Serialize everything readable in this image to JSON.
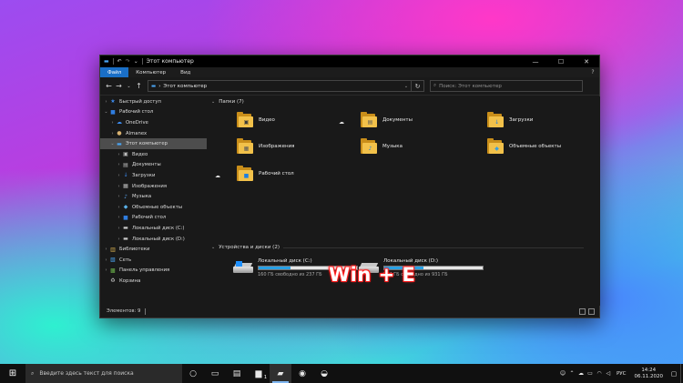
{
  "window": {
    "title": "Этот компьютер",
    "controls": {
      "minimize": "—",
      "maximize": "☐",
      "close": "✕"
    }
  },
  "ribbon": {
    "tabs": [
      {
        "label": "Файл",
        "active": true
      },
      {
        "label": "Компьютер",
        "active": false
      },
      {
        "label": "Вид",
        "active": false
      }
    ],
    "help_icon": "?"
  },
  "navigation": {
    "back": "←",
    "forward": "→",
    "recent": "⌄",
    "up": "↑",
    "address": {
      "separator": "›",
      "location": "Этот компьютер",
      "dropdown": "⌄"
    },
    "refresh": "↻",
    "search_placeholder": "Поиск: Этот компьютер"
  },
  "sidebar": {
    "items": [
      {
        "label": "Быстрый доступ",
        "icon": "star-icon",
        "glyph": "★",
        "color": "#3d8cf0",
        "chevron": "›",
        "indent": 0,
        "selected": false
      },
      {
        "label": "Рабочий стол",
        "icon": "desktop-folder-icon",
        "glyph": "■",
        "color": "#2f7de0",
        "chevron": "⌄",
        "indent": 0,
        "selected": false
      },
      {
        "label": "OneDrive",
        "icon": "onedrive-cloud-icon",
        "glyph": "☁",
        "color": "#3d8cf0",
        "chevron": "›",
        "indent": 1,
        "selected": false
      },
      {
        "label": "Almanex",
        "icon": "user-icon",
        "glyph": "●",
        "color": "#d9b270",
        "chevron": "›",
        "indent": 1,
        "selected": false
      },
      {
        "label": "Этот компьютер",
        "icon": "computer-icon",
        "glyph": "▬",
        "color": "#4aa3f0",
        "chevron": "⌄",
        "indent": 1,
        "selected": true
      },
      {
        "label": "Видео",
        "icon": "video-folder-icon",
        "glyph": "▣",
        "color": "#bdbdbd",
        "chevron": "›",
        "indent": 2,
        "selected": false
      },
      {
        "label": "Документы",
        "icon": "documents-folder-icon",
        "glyph": "▤",
        "color": "#bdbdbd",
        "chevron": "›",
        "indent": 2,
        "selected": false
      },
      {
        "label": "Загрузки",
        "icon": "downloads-folder-icon",
        "glyph": "↓",
        "color": "#3d8cf0",
        "chevron": "›",
        "indent": 2,
        "selected": false
      },
      {
        "label": "Изображения",
        "icon": "pictures-folder-icon",
        "glyph": "▦",
        "color": "#bdbdbd",
        "chevron": "›",
        "indent": 2,
        "selected": false
      },
      {
        "label": "Музыка",
        "icon": "music-folder-icon",
        "glyph": "♪",
        "color": "#5aa0e8",
        "chevron": "›",
        "indent": 2,
        "selected": false
      },
      {
        "label": "Объемные объекты",
        "icon": "3d-objects-folder-icon",
        "glyph": "◆",
        "color": "#5ab0e8",
        "chevron": "›",
        "indent": 2,
        "selected": false
      },
      {
        "label": "Рабочий стол",
        "icon": "desktop-folder-icon",
        "glyph": "■",
        "color": "#2f7de0",
        "chevron": "›",
        "indent": 2,
        "selected": false
      },
      {
        "label": "Локальный диск (C:)",
        "icon": "local-disk-c-icon",
        "glyph": "▬",
        "color": "#c8c8c8",
        "chevron": "›",
        "indent": 2,
        "selected": false
      },
      {
        "label": "Локальный диск (D:)",
        "icon": "local-disk-d-icon",
        "glyph": "▬",
        "color": "#c8c8c8",
        "chevron": "›",
        "indent": 2,
        "selected": false
      },
      {
        "label": "Библиотеки",
        "icon": "libraries-icon",
        "glyph": "▥",
        "color": "#d8b050",
        "chevron": "›",
        "indent": 0,
        "selected": false
      },
      {
        "label": "Сеть",
        "icon": "network-icon",
        "glyph": "▧",
        "color": "#4aa3f0",
        "chevron": "›",
        "indent": 0,
        "selected": false
      },
      {
        "label": "Панель управления",
        "icon": "control-panel-icon",
        "glyph": "▩",
        "color": "#6ab04a",
        "chevron": "›",
        "indent": 0,
        "selected": false
      },
      {
        "label": "Корзина",
        "icon": "recycle-bin-icon",
        "glyph": "♻",
        "color": "#bdbdbd",
        "chevron": "",
        "indent": 0,
        "selected": false
      }
    ]
  },
  "folders_group": {
    "header": "Папки (7)",
    "chevron": "⌄",
    "items": [
      {
        "label": "Видео",
        "name": "video",
        "badge": "▣",
        "badge_color": "#3a3a3a",
        "cloud": false
      },
      {
        "label": "Документы",
        "name": "documents",
        "badge": "▤",
        "badge_color": "#5a5a5a",
        "cloud": true
      },
      {
        "label": "Загрузки",
        "name": "downloads",
        "badge": "↓",
        "badge_color": "#1e7fe0",
        "cloud": false
      },
      {
        "label": "Изображения",
        "name": "pictures",
        "badge": "▦",
        "badge_color": "#5a5a5a",
        "cloud": false
      },
      {
        "label": "Музыка",
        "name": "music",
        "badge": "♪",
        "badge_color": "#1e7fe0",
        "cloud": false
      },
      {
        "label": "Объемные объекты",
        "name": "3d-objects",
        "badge": "◆",
        "badge_color": "#3aa0e0",
        "cloud": false
      },
      {
        "label": "Рабочий стол",
        "name": "desktop",
        "badge": "■",
        "badge_color": "#1e7fe0",
        "cloud": true
      }
    ],
    "cloud_glyph": "☁"
  },
  "devices_group": {
    "header": "Устройства и диски (2)",
    "chevron": "⌄",
    "drives": [
      {
        "label": "Локальный диск (C:)",
        "name": "c",
        "free_text": "160 ГБ свободно из 237 ГБ",
        "used_fraction": 0.325,
        "system": true
      },
      {
        "label": "Локальный диск (D:)",
        "name": "d",
        "free_text": "564 ГБ свободно из 931 ГБ",
        "used_fraction": 0.394,
        "system": false
      }
    ]
  },
  "statusbar": {
    "text": "Элементов: 9"
  },
  "overlay_text": "Win + E",
  "taskbar": {
    "start_glyph": "⊞",
    "search_placeholder": "Введите здесь текст для поиска",
    "search_glyph": "⌕",
    "buttons": [
      {
        "name": "cortana",
        "glyph": "○",
        "active": false,
        "num": ""
      },
      {
        "name": "task-view",
        "glyph": "▭",
        "active": false,
        "num": ""
      },
      {
        "name": "store",
        "glyph": "▤",
        "active": false,
        "num": ""
      },
      {
        "name": "app",
        "glyph": "▆",
        "active": false,
        "num": "1"
      },
      {
        "name": "file-explorer",
        "glyph": "▰",
        "active": true,
        "num": ""
      },
      {
        "name": "chrome",
        "glyph": "◉",
        "active": false,
        "num": ""
      },
      {
        "name": "edge",
        "glyph": "◒",
        "active": false,
        "num": ""
      }
    ],
    "tray": {
      "icons": [
        {
          "name": "people",
          "glyph": "☺"
        },
        {
          "name": "chevron-up",
          "glyph": "⌃"
        },
        {
          "name": "onedrive",
          "glyph": "☁"
        },
        {
          "name": "battery",
          "glyph": "▭"
        },
        {
          "name": "network",
          "glyph": "◠"
        },
        {
          "name": "volume",
          "glyph": "◁"
        }
      ],
      "language": "РУС",
      "time": "14:24",
      "date": "06.11.2020",
      "notification_glyph": "▢"
    }
  }
}
